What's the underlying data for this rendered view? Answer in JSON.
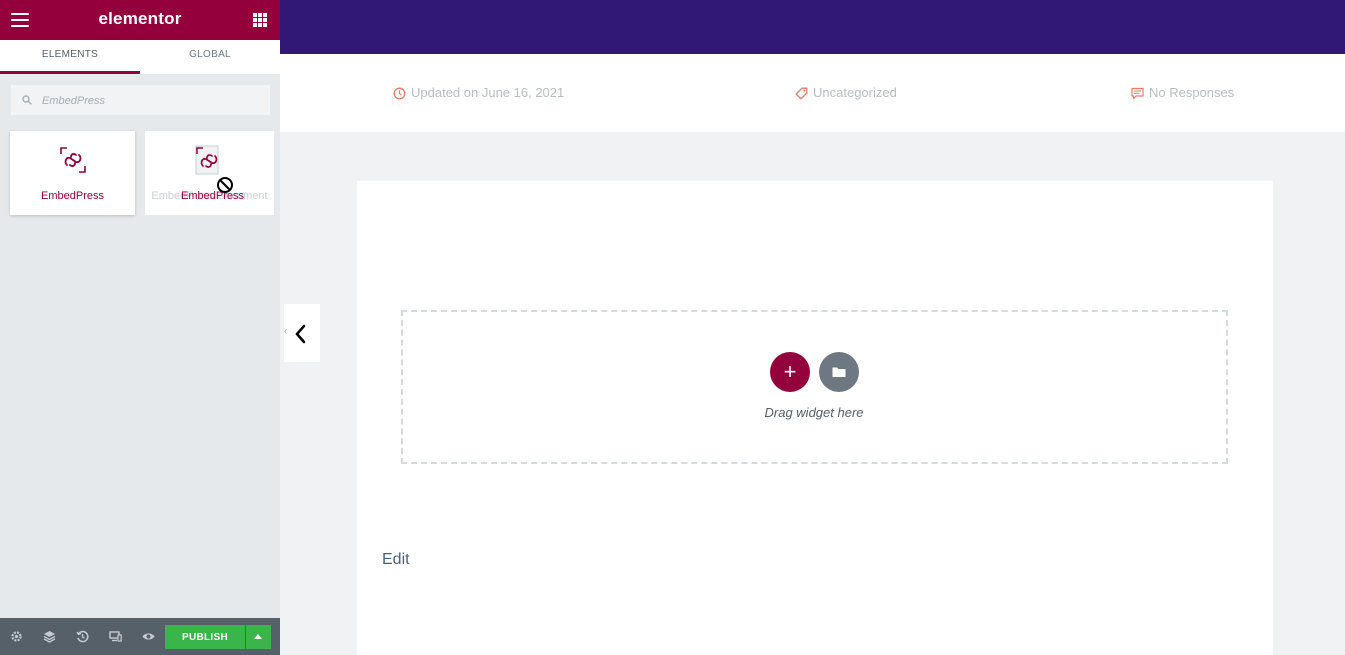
{
  "panel": {
    "logo": "elementor",
    "tabs": [
      {
        "label": "ELEMENTS",
        "active": true
      },
      {
        "label": "GLOBAL",
        "active": false
      }
    ],
    "search": {
      "placeholder": "EmbedPress",
      "value": ""
    },
    "widgets": [
      {
        "label": "EmbedPress",
        "icon": "embedpress-icon"
      },
      {
        "label": "EmbedPress Document",
        "icon": "embedpress-document-icon"
      }
    ],
    "drag_ghost_label": "EmbedPress",
    "footer": {
      "icons": [
        "settings-icon",
        "layers-icon",
        "history-icon",
        "responsive-icon",
        "preview-icon"
      ],
      "publish_label": "PUBLISH"
    },
    "accent_color": "#93003c"
  },
  "meta": {
    "updated": "Updated on June 16, 2021",
    "category": "Uncategorized",
    "responses": "No Responses"
  },
  "canvas": {
    "drag_text": "Drag widget here",
    "add_label": "+",
    "edit_link": "Edit",
    "header_color": "#311876"
  }
}
